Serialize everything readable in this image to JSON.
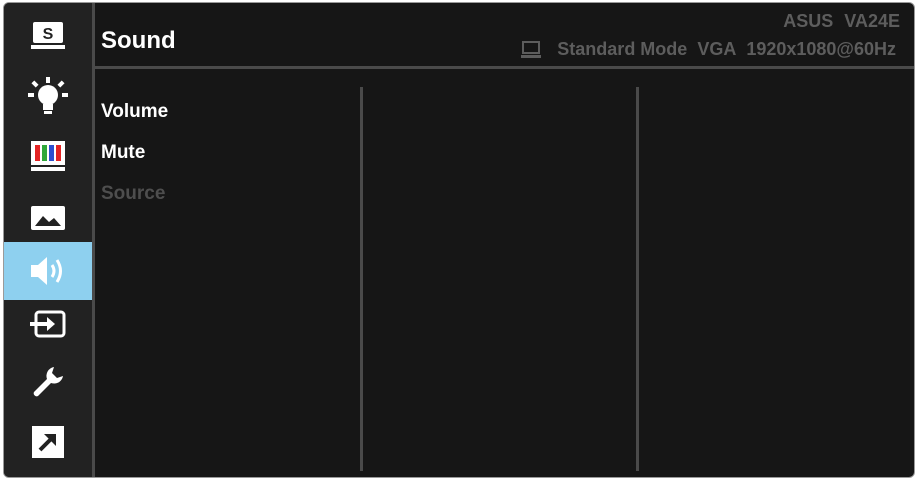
{
  "header": {
    "title": "Sound",
    "model_brand": "ASUS",
    "model_name": "VA24E",
    "mode": "Standard Mode",
    "input": "VGA",
    "resolution": "1920x1080@60Hz"
  },
  "sidebar": {
    "items": [
      {
        "name": "splendid",
        "icon": "splendid-s-icon",
        "label": "S"
      },
      {
        "name": "blue-light",
        "icon": "brightness-icon"
      },
      {
        "name": "color",
        "icon": "color-bars-icon"
      },
      {
        "name": "image",
        "icon": "image-icon"
      },
      {
        "name": "sound",
        "icon": "speaker-icon",
        "active": true
      },
      {
        "name": "input-select",
        "icon": "input-icon"
      },
      {
        "name": "system-setup",
        "icon": "wrench-icon"
      },
      {
        "name": "shortcut",
        "icon": "shortcut-arrow-icon"
      }
    ]
  },
  "menu": {
    "items": [
      {
        "label": "Volume",
        "enabled": true
      },
      {
        "label": "Mute",
        "enabled": true
      },
      {
        "label": "Source",
        "enabled": false
      }
    ]
  },
  "colors": {
    "active_highlight": "#8ed0ef",
    "background": "#161616",
    "disabled_text": "#4e4e4e",
    "status_text": "#5d5d5d"
  }
}
